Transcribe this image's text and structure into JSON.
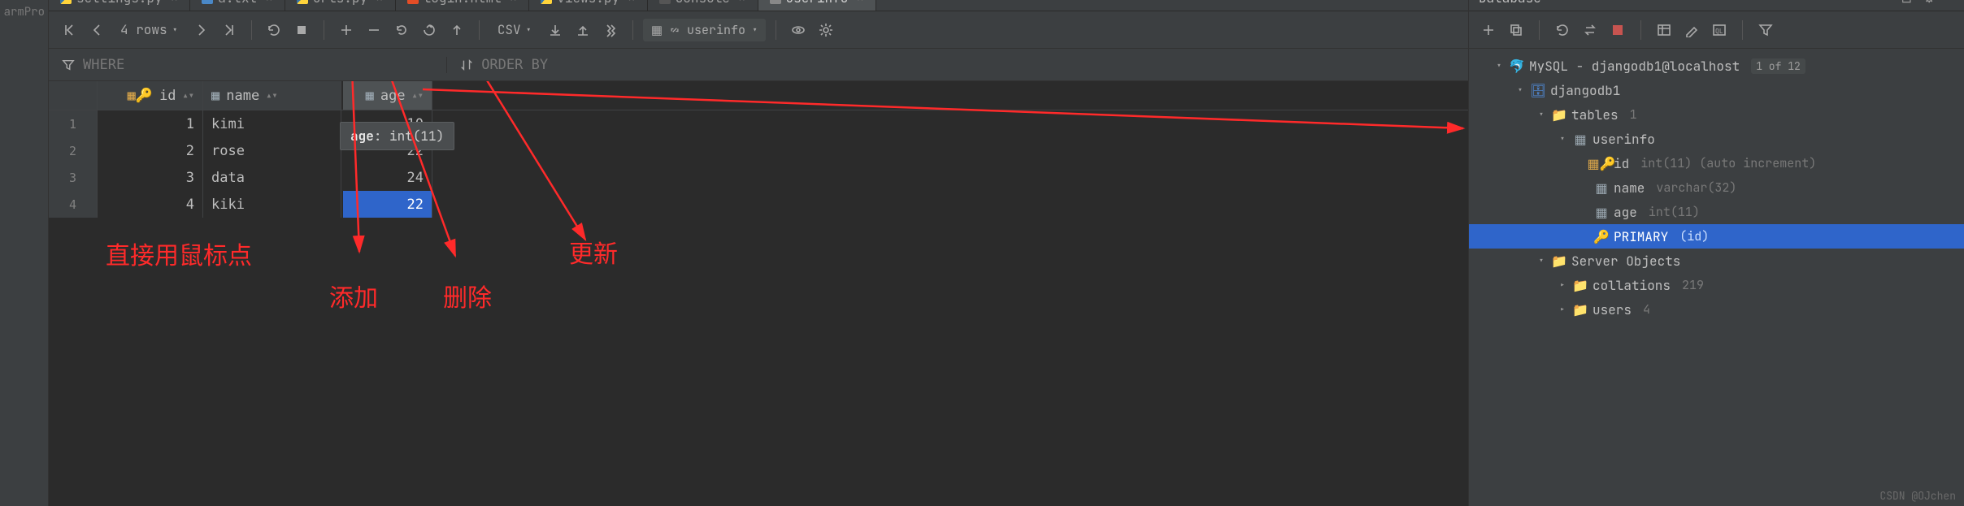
{
  "left_gutter": "armPro",
  "tabs": [
    {
      "label": "settings.py",
      "icon": "py",
      "active": false
    },
    {
      "label": "a.txt",
      "icon": "txt",
      "active": false
    },
    {
      "label": "urls.py",
      "icon": "py",
      "active": false
    },
    {
      "label": "login.html",
      "icon": "html",
      "active": false
    },
    {
      "label": "views.py",
      "icon": "py",
      "active": false
    },
    {
      "label": "console",
      "icon": "term",
      "active": false
    },
    {
      "label": "userinfo",
      "icon": "tbl",
      "active": true
    }
  ],
  "toolbar": {
    "rows_label": "4 rows",
    "export_label": "CSV",
    "table_chip": "userinfo"
  },
  "filter": {
    "where": "WHERE",
    "order": "ORDER BY"
  },
  "columns": [
    {
      "name": "id",
      "icon": "key"
    },
    {
      "name": "name",
      "icon": "table"
    },
    {
      "name": "age",
      "icon": "table",
      "active": true
    }
  ],
  "rows": [
    {
      "n": "1",
      "id": "1",
      "name": "kimi",
      "age": "10"
    },
    {
      "n": "2",
      "id": "2",
      "name": "rose",
      "age": "22"
    },
    {
      "n": "3",
      "id": "3",
      "name": "data",
      "age": "24"
    },
    {
      "n": "4",
      "id": "4",
      "name": "kiki",
      "age": "22",
      "selected": true
    }
  ],
  "tooltip": {
    "col": "age",
    "type": "int(11)"
  },
  "annotations": {
    "mouse": "直接用鼠标点",
    "add": "添加",
    "delete": "删除",
    "update": "更新"
  },
  "database": {
    "panel_title": "Database",
    "root": {
      "label": "MySQL - djangodb1@localhost",
      "badge": "1 of 12"
    },
    "schema": "djangodb1",
    "tables_label": "tables",
    "tables_count": "1",
    "table": "userinfo",
    "cols": [
      {
        "name": "id",
        "type": "int(11) (auto increment)",
        "icon": "key"
      },
      {
        "name": "name",
        "type": "varchar(32)",
        "icon": "col"
      },
      {
        "name": "age",
        "type": "int(11)",
        "icon": "col"
      }
    ],
    "primary": {
      "label": "PRIMARY",
      "detail": "(id)"
    },
    "server_objects": "Server Objects",
    "collations": {
      "label": "collations",
      "count": "219"
    },
    "users": {
      "label": "users",
      "count": "4"
    }
  },
  "watermark": "CSDN @OJchen"
}
